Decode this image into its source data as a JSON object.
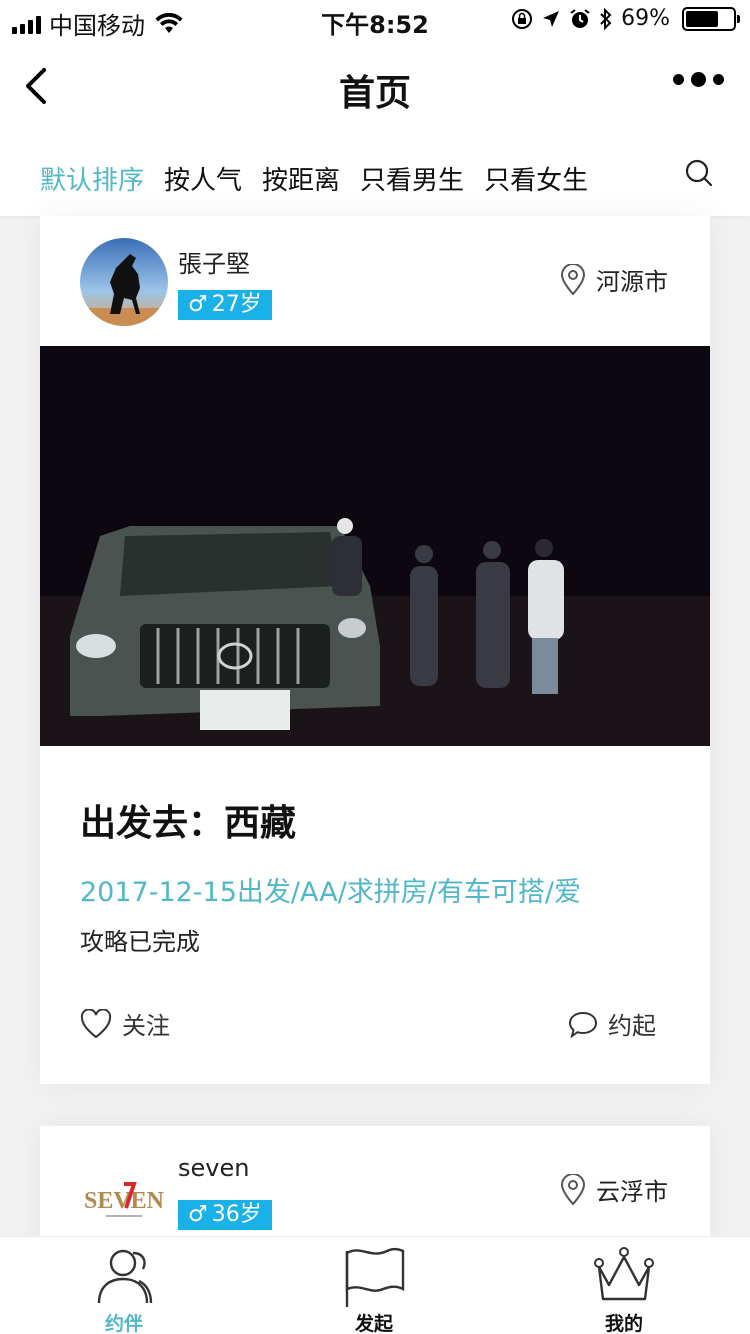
{
  "status_bar": {
    "carrier": "中国移动",
    "time": "下午8:52",
    "battery_text": "69%",
    "battery_level": 0.69
  },
  "nav": {
    "title": "首页"
  },
  "filters": {
    "tabs": [
      "默认排序",
      "按人气",
      "按距离",
      "只看男生",
      "只看女生"
    ],
    "active_index": 0
  },
  "posts": [
    {
      "username": "張子堅",
      "gender_symbol": "♂",
      "age": "27岁",
      "location": "河源市",
      "title": "出发去：西藏",
      "tags": "2017-12-15出发/AA/求拼房/有车可搭/爱",
      "description": "攻略已完成",
      "follow_label": "关注",
      "invite_label": "约起"
    },
    {
      "username": "seven",
      "gender_symbol": "♂",
      "age": "36岁",
      "location": "云浮市",
      "avatar_logo_text": "SEVEN"
    }
  ],
  "tab_bar": {
    "items": [
      "约伴",
      "发起",
      "我的"
    ],
    "active_index": 0
  },
  "colors": {
    "accent": "#52b7c8",
    "badge": "#19b1e8"
  }
}
